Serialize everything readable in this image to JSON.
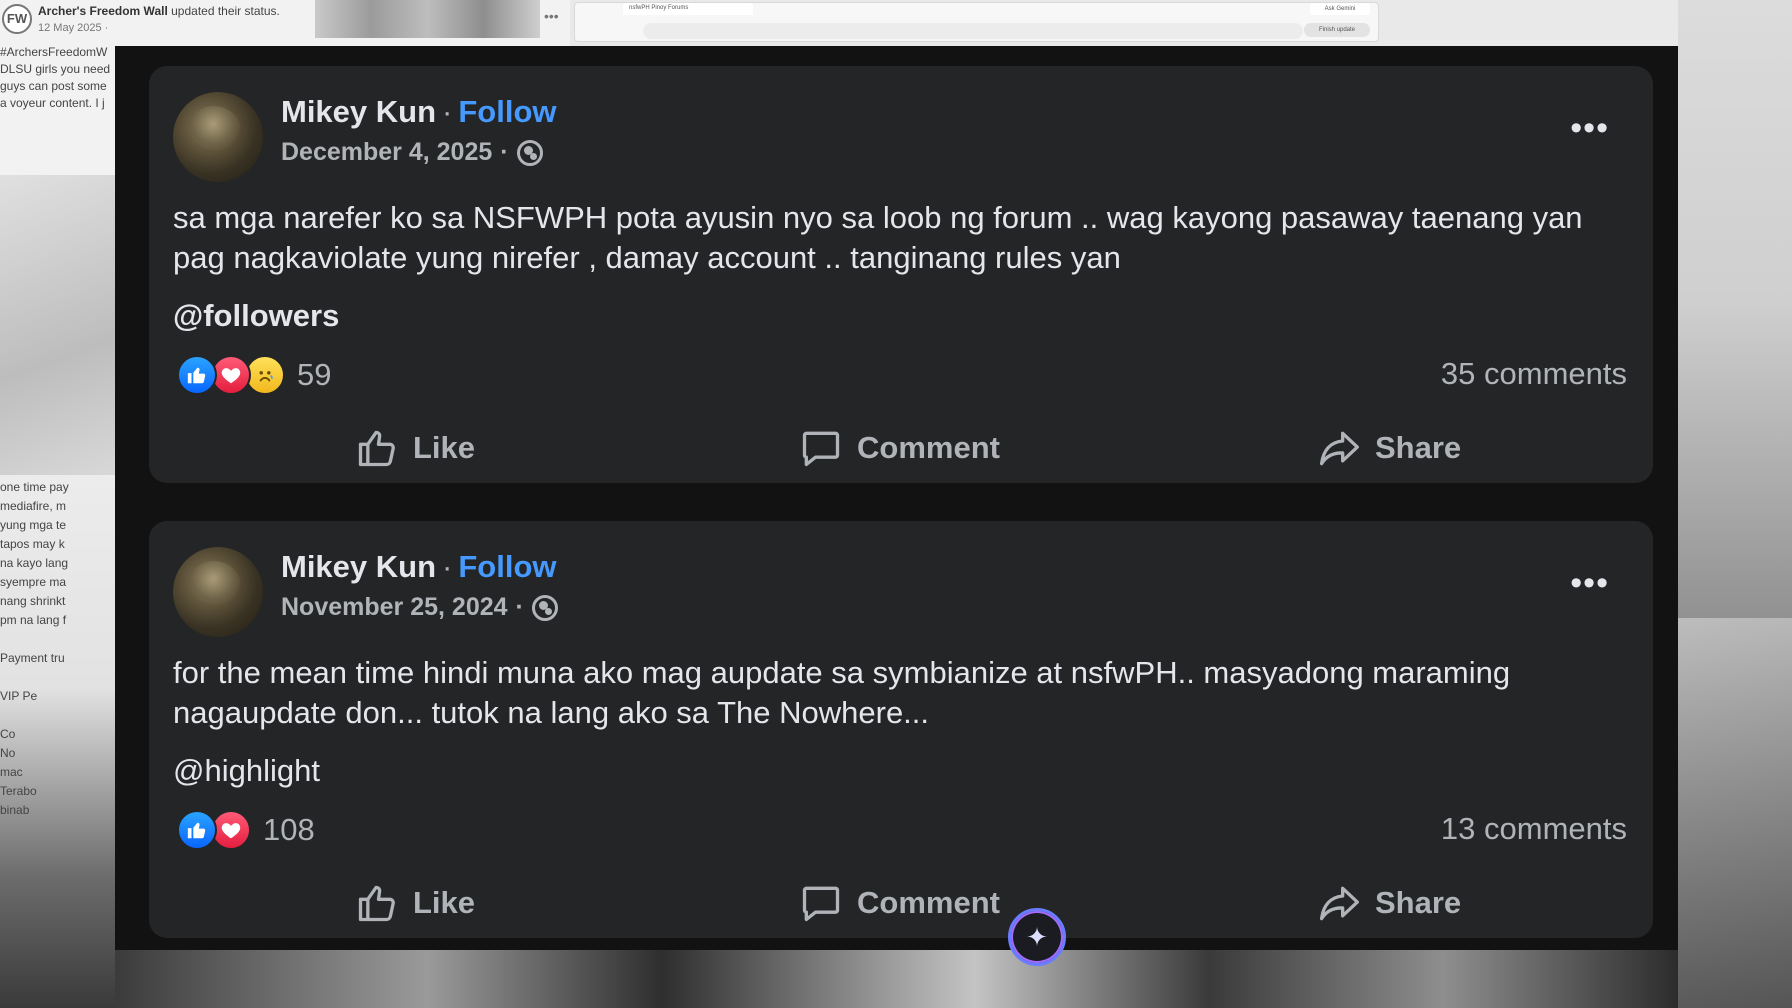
{
  "background": {
    "post": {
      "avatar_initials": "FW",
      "name": "Archer's Freedom Wall",
      "status": "updated their status.",
      "date": "12 May 2025 ·",
      "more": "•••"
    },
    "snippet_lines": [
      "#ArchersFreedomW",
      "DLSU girls you need",
      "guys can post some",
      "a voyeur content. I j"
    ],
    "snippet_lines_lower": [
      "one time pay",
      "mediafire, m",
      "yung mga te",
      "tapos may k",
      "na  kayo lang",
      "syempre ma",
      "nang shrinkt",
      "pm na lang f",
      "",
      "Payment tru",
      "",
      "VIP Pe",
      "",
      "Co",
      "No",
      "mac",
      "Terabo",
      "binab"
    ],
    "browser": {
      "tab_label": "nsfwPH Pinoy Forums",
      "gemini_label": "Ask Gemini",
      "update_label": "Finish update"
    }
  },
  "posts": [
    {
      "author": "Mikey Kun",
      "separator": "·",
      "follow_label": "Follow",
      "date": "December 4, 2025",
      "date_separator": "·",
      "body": "sa mga narefer ko sa NSFWPH pota ayusin nyo sa loob ng forum .. wag kayong pasaway taenang yan pag nagkaviolate yung nirefer ,  damay account .. tanginang rules yan",
      "tag": "@followers",
      "reactions": [
        "like",
        "love",
        "sad"
      ],
      "reaction_count": "59",
      "comments": "35 comments",
      "actions": {
        "like": "Like",
        "comment": "Comment",
        "share": "Share"
      }
    },
    {
      "author": "Mikey Kun",
      "separator": "·",
      "follow_label": "Follow",
      "date": "November 25, 2024",
      "date_separator": "·",
      "body": "for the mean time hindi muna ako mag aupdate sa symbianize at nsfwPH.. masyadong maraming nagaupdate don... tutok na lang ako sa The Nowhere...",
      "tag": "@highlight",
      "reactions": [
        "like",
        "love"
      ],
      "reaction_count": "108",
      "comments": "13 comments",
      "actions": {
        "like": "Like",
        "comment": "Comment",
        "share": "Share"
      }
    }
  ],
  "icons": {
    "more": "more-horizontal-icon",
    "globe": "globe-icon",
    "like": "thumbs-up-icon",
    "comment": "comment-bubble-icon",
    "share": "share-arrow-icon",
    "assistant": "sparkle-icon"
  },
  "colors": {
    "panel_bg": "#121212",
    "card_bg": "#242526",
    "text_primary": "#e4e6eb",
    "text_secondary": "#b0b3b8",
    "follow_blue": "#4599ff",
    "like_blue": "#0866ff",
    "love_red": "#e41e3f",
    "sad_yellow": "#f2b81d"
  }
}
